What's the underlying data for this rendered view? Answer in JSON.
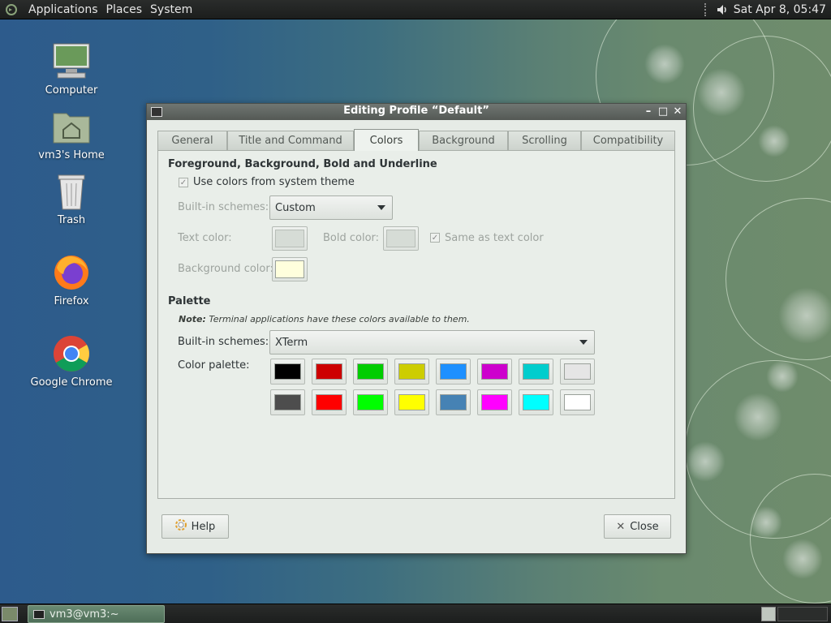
{
  "top_panel": {
    "menus": [
      "Applications",
      "Places",
      "System"
    ],
    "clock": "Sat Apr  8, 05:47"
  },
  "desktop": {
    "icons": [
      {
        "label": "Computer",
        "icon": "computer-icon"
      },
      {
        "label": "vm3's Home",
        "icon": "home-folder-icon"
      },
      {
        "label": "Trash",
        "icon": "trash-icon"
      },
      {
        "label": "Firefox",
        "icon": "firefox-icon"
      },
      {
        "label": "Google Chrome",
        "icon": "chrome-icon"
      }
    ]
  },
  "dialog": {
    "title": "Editing Profile “Default”",
    "tabs": [
      "General",
      "Title and Command",
      "Colors",
      "Background",
      "Scrolling",
      "Compatibility"
    ],
    "active_tab": "Colors",
    "fg_section": {
      "heading": "Foreground, Background, Bold and Underline",
      "use_system_colors_label": "Use colors from system theme",
      "use_system_colors_checked": true,
      "builtin_schemes_label": "Built-in schemes:",
      "builtin_schemes_value": "Custom",
      "text_color_label": "Text color:",
      "bold_color_label": "Bold color:",
      "same_as_text_label": "Same as text color",
      "same_as_text_checked": true,
      "background_color_label": "Background color:"
    },
    "palette_section": {
      "heading": "Palette",
      "note_bold": "Note:",
      "note_text": " Terminal applications have these colors available to them.",
      "builtin_schemes_label": "Built-in schemes:",
      "builtin_schemes_value": "XTerm",
      "color_palette_label": "Color palette:"
    },
    "buttons": {
      "help": "Help",
      "close": "Close"
    }
  },
  "colors": {
    "text_color": "#d6dcd6",
    "bold_color": "#d6dcd6",
    "background_color": "#ffffdd",
    "palette_row1": [
      "#000000",
      "#cd0000",
      "#00cd00",
      "#cdcd00",
      "#1e90ff",
      "#cd00cd",
      "#00cdcd",
      "#e5e5e5"
    ],
    "palette_row2": [
      "#4d4d4d",
      "#ff0000",
      "#00ff00",
      "#ffff00",
      "#4682b4",
      "#ff00ff",
      "#00ffff",
      "#ffffff"
    ]
  },
  "bottom_panel": {
    "task_label": "vm3@vm3:~"
  }
}
